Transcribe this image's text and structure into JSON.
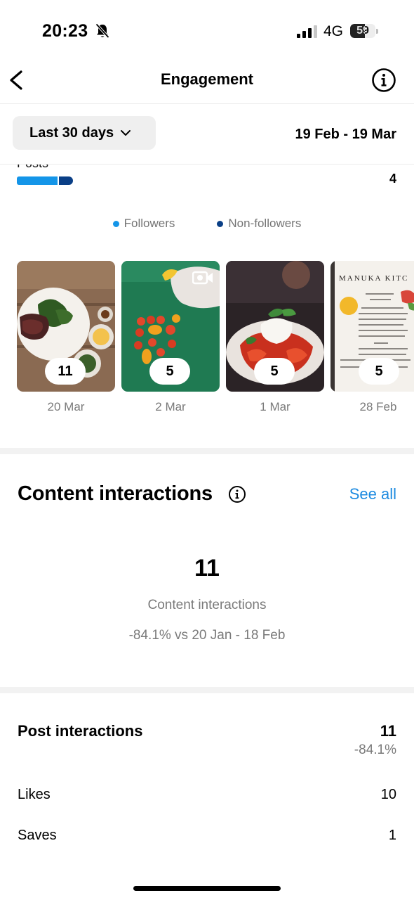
{
  "status_bar": {
    "time": "20:23",
    "network": "4G",
    "battery": "59",
    "battery_level": 0.59
  },
  "header": {
    "title": "Engagement"
  },
  "filter": {
    "range_label": "Last 30 days",
    "date_range": "19 Feb - 19 Mar"
  },
  "posts_breakdown": {
    "label": "Posts",
    "value": "4",
    "followers_share": 0.75,
    "colors": {
      "followers": "#1495e8",
      "non_followers": "#0a3f86"
    }
  },
  "legend": {
    "followers": "Followers",
    "non_followers": "Non-followers"
  },
  "posts": [
    {
      "date": "20 Mar",
      "count": "11",
      "type": "photo",
      "image": "steak-and-salad-plate"
    },
    {
      "date": "2 Mar",
      "count": "5",
      "type": "reel",
      "image": "cherry-tomatoes-on-board"
    },
    {
      "date": "1 Mar",
      "count": "5",
      "type": "photo",
      "image": "burrata-tomato-salad"
    },
    {
      "date": "28 Feb",
      "count": "5",
      "type": "carousel",
      "image": "menu-card",
      "menu_heading": "MANUKA KITC"
    }
  ],
  "content_interactions": {
    "title": "Content interactions",
    "see_all": "See all",
    "total": "11",
    "label": "Content interactions",
    "comparison": "-84.1% vs 20 Jan - 18 Feb"
  },
  "post_interactions": {
    "title": "Post interactions",
    "total": "11",
    "change": "-84.1%",
    "rows": [
      {
        "label": "Likes",
        "value": "10"
      },
      {
        "label": "Saves",
        "value": "1"
      }
    ]
  }
}
